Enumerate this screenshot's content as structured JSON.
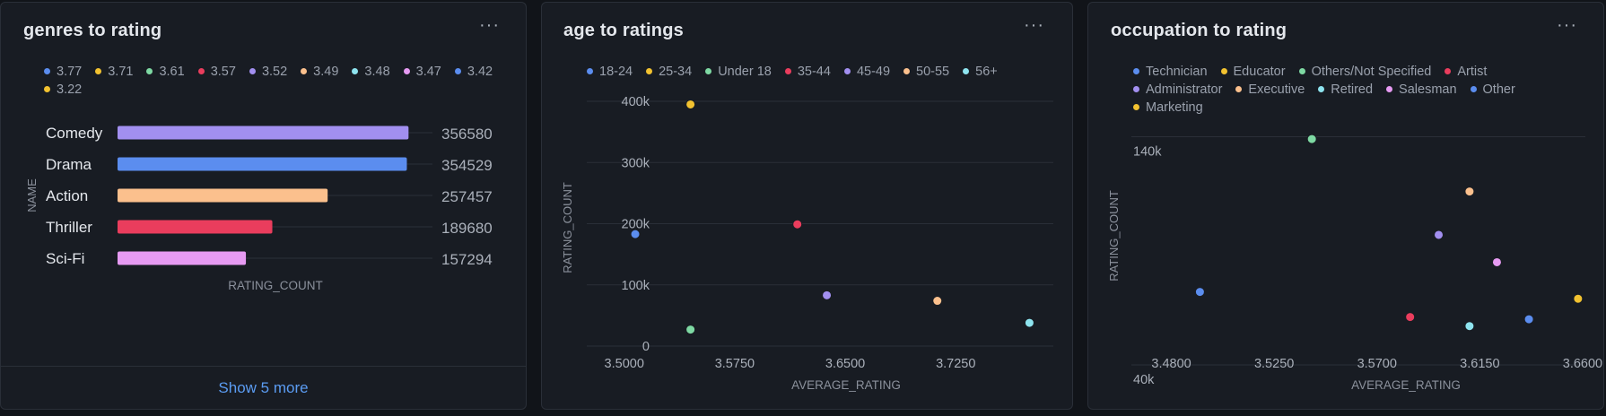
{
  "panels": [
    {
      "title": "genres to rating",
      "menu_label": "···",
      "show_more": "Show 5 more"
    },
    {
      "title": "age to ratings",
      "menu_label": "···"
    },
    {
      "title": "occupation to rating",
      "menu_label": "···"
    }
  ],
  "colors": {
    "blue": "#5b8def",
    "yellow": "#f2c230",
    "green": "#7ed9a3",
    "red": "#ea3d5d",
    "purple": "#a28ff0",
    "peach": "#fbc08d",
    "cyan": "#8ee4ef",
    "pink": "#e69af2"
  },
  "chart_data": [
    {
      "type": "bar",
      "orientation": "horizontal",
      "title": "genres to rating",
      "xlabel": "RATING_COUNT",
      "ylabel": "NAME",
      "categories": [
        "Comedy",
        "Drama",
        "Action",
        "Thriller",
        "Sci-Fi"
      ],
      "values": [
        356580,
        354529,
        257457,
        189680,
        157294
      ],
      "bar_colors": [
        "#a28ff0",
        "#5b8def",
        "#fbc08d",
        "#ea3d5d",
        "#e69af2"
      ],
      "xlim": [
        0,
        365000
      ],
      "legend": [
        {
          "label": "3.77",
          "color": "#5b8def"
        },
        {
          "label": "3.71",
          "color": "#f2c230"
        },
        {
          "label": "3.61",
          "color": "#7ed9a3"
        },
        {
          "label": "3.57",
          "color": "#ea3d5d"
        },
        {
          "label": "3.52",
          "color": "#a28ff0"
        },
        {
          "label": "3.49",
          "color": "#fbc08d"
        },
        {
          "label": "3.48",
          "color": "#8ee4ef"
        },
        {
          "label": "3.47",
          "color": "#e69af2"
        },
        {
          "label": "3.42",
          "color": "#5b8def"
        },
        {
          "label": "3.22",
          "color": "#f2c230"
        }
      ],
      "legend_position": "top"
    },
    {
      "type": "scatter",
      "title": "age to ratings",
      "xlabel": "AVERAGE_RATING",
      "ylabel": "RATING_COUNT",
      "xlim": [
        3.4746,
        3.7912
      ],
      "ylim": [
        0,
        425000
      ],
      "xticks": [
        3.5,
        3.575,
        3.65,
        3.725
      ],
      "xtick_labels": [
        "3.5000",
        "3.5750",
        "3.6500",
        "3.7250"
      ],
      "yticks": [
        0,
        100000,
        200000,
        300000,
        400000
      ],
      "ytick_labels": [
        "0",
        "100k",
        "200k",
        "300k",
        "400k"
      ],
      "series": [
        {
          "name": "18-24",
          "color": "#5b8def",
          "x": 3.5075,
          "y": 183000
        },
        {
          "name": "25-34",
          "color": "#f2c230",
          "x": 3.545,
          "y": 395000
        },
        {
          "name": "Under 18",
          "color": "#7ed9a3",
          "x": 3.545,
          "y": 27000
        },
        {
          "name": "35-44",
          "color": "#ea3d5d",
          "x": 3.6175,
          "y": 199000
        },
        {
          "name": "45-49",
          "color": "#a28ff0",
          "x": 3.6375,
          "y": 83000
        },
        {
          "name": "50-55",
          "color": "#fbc08d",
          "x": 3.7125,
          "y": 74000
        },
        {
          "name": "56+",
          "color": "#8ee4ef",
          "x": 3.775,
          "y": 38000
        }
      ],
      "legend_position": "top"
    },
    {
      "type": "scatter",
      "title": "occupation to rating",
      "xlabel": "AVERAGE_RATING",
      "ylabel": "RATING_COUNT",
      "xlim": [
        3.4625,
        3.6612
      ],
      "ylim": [
        40000,
        152000
      ],
      "xticks": [
        3.48,
        3.525,
        3.57,
        3.615,
        3.66
      ],
      "xtick_labels": [
        "3.4800",
        "3.5250",
        "3.5700",
        "3.6150",
        "3.6600"
      ],
      "yticks": [
        40000,
        140000
      ],
      "ytick_labels": [
        "40k",
        "140k"
      ],
      "series": [
        {
          "name": "Technician",
          "color": "#5b8def",
          "x": 3.4925,
          "y": 72000
        },
        {
          "name": "Educator",
          "color": "#f2c230",
          "x": 3.658,
          "y": 69000
        },
        {
          "name": "Others/Not Specified",
          "color": "#7ed9a3",
          "x": 3.5415,
          "y": 139000
        },
        {
          "name": "Artist",
          "color": "#ea3d5d",
          "x": 3.5845,
          "y": 61000
        },
        {
          "name": "Administrator",
          "color": "#a28ff0",
          "x": 3.597,
          "y": 97000
        },
        {
          "name": "Executive",
          "color": "#fbc08d",
          "x": 3.6105,
          "y": 116000
        },
        {
          "name": "Retired",
          "color": "#8ee4ef",
          "x": 3.6105,
          "y": 57000
        },
        {
          "name": "Salesman",
          "color": "#e69af2",
          "x": 3.6225,
          "y": 85000
        },
        {
          "name": "Other",
          "color": "#5b8def",
          "x": 3.6365,
          "y": 60000
        },
        {
          "name": "Marketing",
          "color": "#f2c230",
          "x": 3.658,
          "y": 69000
        }
      ],
      "legend_position": "top"
    }
  ]
}
